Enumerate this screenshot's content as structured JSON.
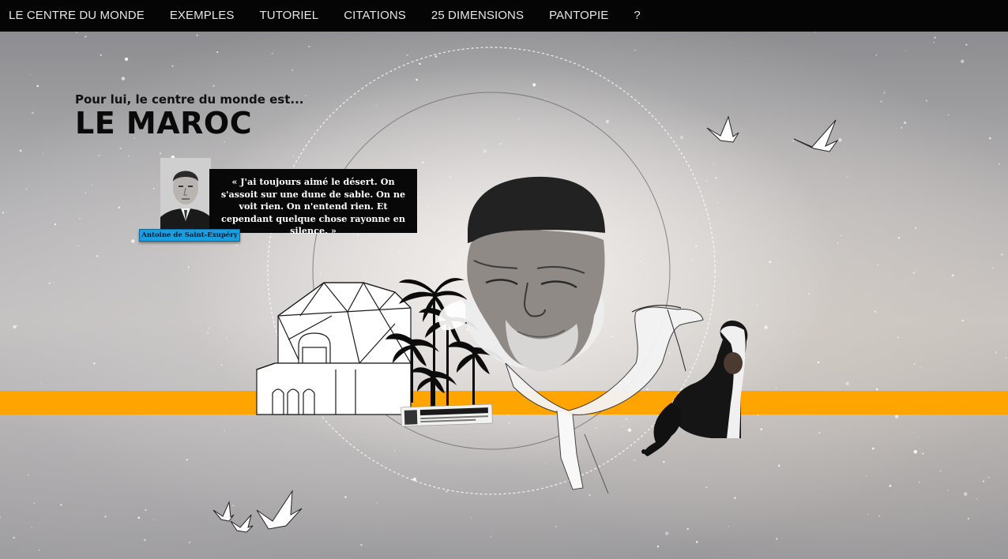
{
  "nav": {
    "items": [
      {
        "label": "LE CENTRE DU MONDE"
      },
      {
        "label": "EXEMPLES"
      },
      {
        "label": "TUTORIEL"
      },
      {
        "label": "CITATIONS"
      },
      {
        "label": "25 DIMENSIONS"
      },
      {
        "label": "PANTOPIE"
      },
      {
        "label": "?"
      }
    ]
  },
  "hero": {
    "subtitle": "Pour lui, le centre du monde est...",
    "title": "LE MAROC"
  },
  "quote": {
    "text": "« J'ai toujours aimé le désert. On s'assoit sur une dune de sable. On ne voit rien. On n'entend rien. Et cependant quelque chose rayonne en silence. »",
    "author": "Antoine de Saint-Exupéry"
  },
  "colors": {
    "band": "#ffa400",
    "nav_bg": "#050505",
    "badge": "#1a9ee0"
  },
  "icons": [
    "paper-crane-icon",
    "palm-tree-icon",
    "camel-icon",
    "mosque-arch-icon"
  ]
}
